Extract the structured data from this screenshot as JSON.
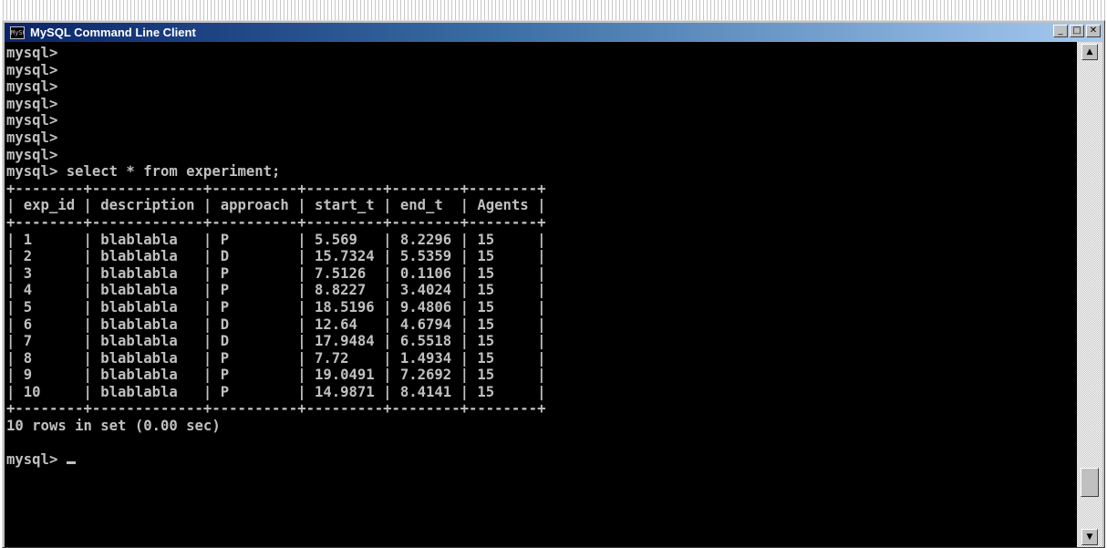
{
  "window": {
    "title": "MySQL Command Line Client",
    "icon_label": "MySQL",
    "controls": {
      "minimize_glyph": "_",
      "maximize_glyph": "□",
      "close_glyph": "✕"
    },
    "icons": [
      "mysql-console-icon",
      "minimize-icon",
      "maximize-icon",
      "close-icon",
      "scroll-up-arrow-icon",
      "scroll-down-arrow-icon"
    ]
  },
  "console": {
    "lines": [
      "mysql>",
      "mysql>",
      "mysql>",
      "mysql>",
      "mysql>",
      "mysql>",
      "mysql>",
      "mysql> select * from experiment;",
      "+--------+-------------+----------+---------+--------+--------+",
      "| exp_id | description | approach | start_t | end_t  | Agents |",
      "+--------+-------------+----------+---------+--------+--------+",
      "| 1      | blablabla   | P        | 5.569   | 8.2296 | 15     |",
      "| 2      | blablabla   | D        | 15.7324 | 5.5359 | 15     |",
      "| 3      | blablabla   | P        | 7.5126  | 0.1106 | 15     |",
      "| 4      | blablabla   | P        | 8.8227  | 3.4024 | 15     |",
      "| 5      | blablabla   | P        | 18.5196 | 9.4806 | 15     |",
      "| 6      | blablabla   | D        | 12.64   | 4.6794 | 15     |",
      "| 7      | blablabla   | D        | 17.9484 | 6.5518 | 15     |",
      "| 8      | blablabla   | P        | 7.72    | 1.4934 | 15     |",
      "| 9      | blablabla   | P        | 19.0491 | 7.2692 | 15     |",
      "| 10     | blablabla   | P        | 14.9871 | 8.4141 | 15     |",
      "+--------+-------------+----------+---------+--------+--------+",
      "10 rows in set (0.00 sec)",
      "",
      "mysql> "
    ],
    "colors": {
      "background": "#000000",
      "text": "#c0c0c0"
    }
  },
  "scrollbar": {
    "up_glyph": "▲",
    "down_glyph": "▼",
    "scroll_position": 0.93
  }
}
